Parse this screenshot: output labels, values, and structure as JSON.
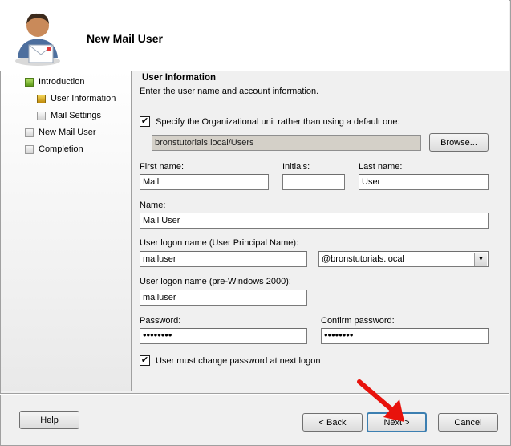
{
  "header": {
    "title": "New Mail User"
  },
  "nav": {
    "items": [
      {
        "label": "Introduction"
      },
      {
        "label": "User Information"
      },
      {
        "label": "Mail Settings"
      },
      {
        "label": "New Mail User"
      },
      {
        "label": "Completion"
      }
    ]
  },
  "section": {
    "title": "User Information",
    "subtitle": "Enter the user name and account information."
  },
  "ou": {
    "checkbox_label": "Specify the Organizational unit rather than using a default one:",
    "checked": true,
    "value": "bronstutorials.local/Users",
    "browse_label": "Browse..."
  },
  "fields": {
    "first_name_label": "First name:",
    "first_name_value": "Mail",
    "initials_label": "Initials:",
    "initials_value": "",
    "last_name_label": "Last name:",
    "last_name_value": "User",
    "name_label": "Name:",
    "name_value": "Mail User",
    "upn_label": "User logon name (User Principal Name):",
    "upn_value": "mailuser",
    "upn_domain": "@bronstutorials.local",
    "prewin_label": "User logon name (pre-Windows 2000):",
    "prewin_value": "mailuser",
    "password_label": "Password:",
    "password_value": "••••••••",
    "confirm_label": "Confirm password:",
    "confirm_value": "••••••••"
  },
  "change_pwd": {
    "label": "User must change password at next logon",
    "checked": true
  },
  "buttons": {
    "help": "Help",
    "back": "< Back",
    "next": "Next >",
    "cancel": "Cancel"
  },
  "icons": {
    "header": "user-mail-icon",
    "annotation": "red-arrow-icon"
  },
  "colors": {
    "annotation_arrow": "#e8120c",
    "focus_border": "#3c7fb1"
  }
}
